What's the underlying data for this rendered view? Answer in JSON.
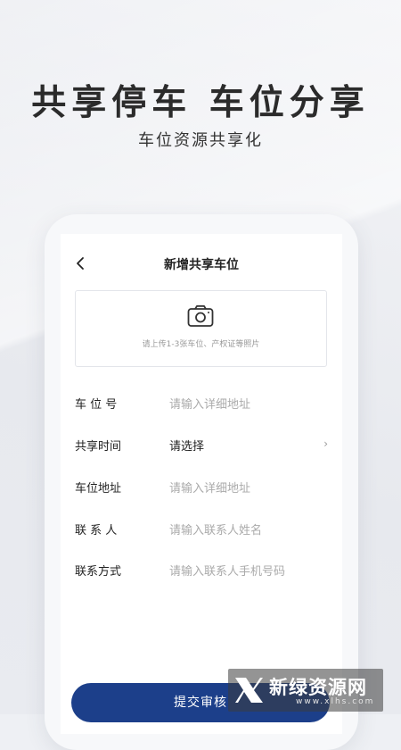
{
  "promo": {
    "headline": "共享停车 车位分享",
    "subline": "车位资源共享化"
  },
  "screen": {
    "title": "新增共享车位",
    "back_icon": "chevron-left-icon",
    "upload": {
      "icon": "camera-icon",
      "hint": "请上传1-3张车位、产权证等照片"
    },
    "fields": [
      {
        "label": "车 位 号",
        "value": "请输入详细地址",
        "placeholder": true
      },
      {
        "label": "共享时间",
        "value": "请选择",
        "placeholder": false,
        "chevron": "›"
      },
      {
        "label": "车位地址",
        "value": "请输入详细地址",
        "placeholder": true
      },
      {
        "label": "联 系 人",
        "value": "请输入联系人姓名",
        "placeholder": true
      },
      {
        "label": "联系方式",
        "value": "请输入联系人手机号码",
        "placeholder": true
      }
    ],
    "submit_label": "提交审核"
  },
  "watermark": {
    "text": "新绿资源网",
    "sub": "www.xlhs.com"
  },
  "colors": {
    "accent": "#1c3f8a",
    "placeholder": "#aaaaaa",
    "text": "#222222"
  }
}
